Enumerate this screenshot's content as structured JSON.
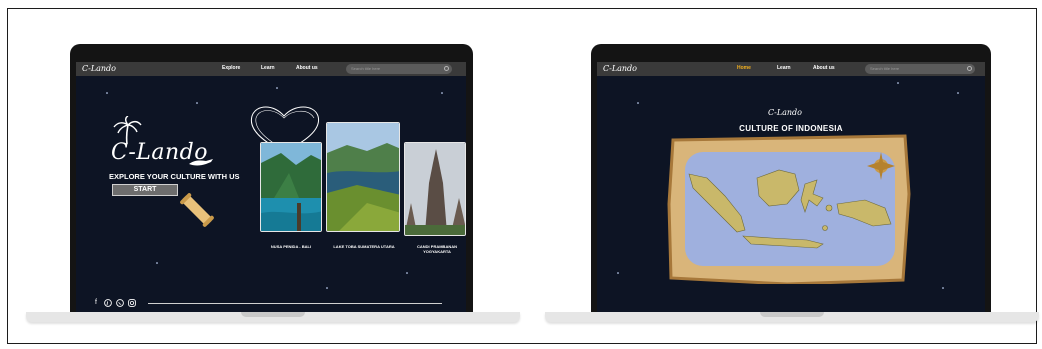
{
  "laptop_left": {
    "nav": {
      "logo": "C-Lando",
      "links": [
        "Explore",
        "Learn",
        "About us"
      ],
      "search_placeholder": "Search title here"
    },
    "hero": {
      "brand": "C-Lando",
      "tagline": "EXPLORE YOUR CULTURE WITH US",
      "start_label": "START"
    },
    "cards": [
      {
        "caption": "NUSA PENIDA - BALI"
      },
      {
        "caption": "LAKE TOBA SUMATERA UTARA"
      },
      {
        "caption": "CANDI PRAMBANAN YOGYAKARTA"
      }
    ],
    "social_icons": [
      "facebook-icon",
      "pinterest-icon",
      "whatsapp-icon",
      "instagram-icon"
    ]
  },
  "laptop_right": {
    "nav": {
      "logo": "C-Lando",
      "links": [
        "Home",
        "Learn",
        "About us"
      ],
      "active": "Home",
      "search_placeholder": "Search title here"
    },
    "logo_small": "C-Lando",
    "title": "CULTURE OF INDONESIA"
  },
  "colors": {
    "screen_bg": "#0d1424",
    "nav_bg": "#3a3a3a",
    "accent": "#f2b01e",
    "map_sea": "#9fb0de",
    "map_parchment": "#d9b57a"
  }
}
